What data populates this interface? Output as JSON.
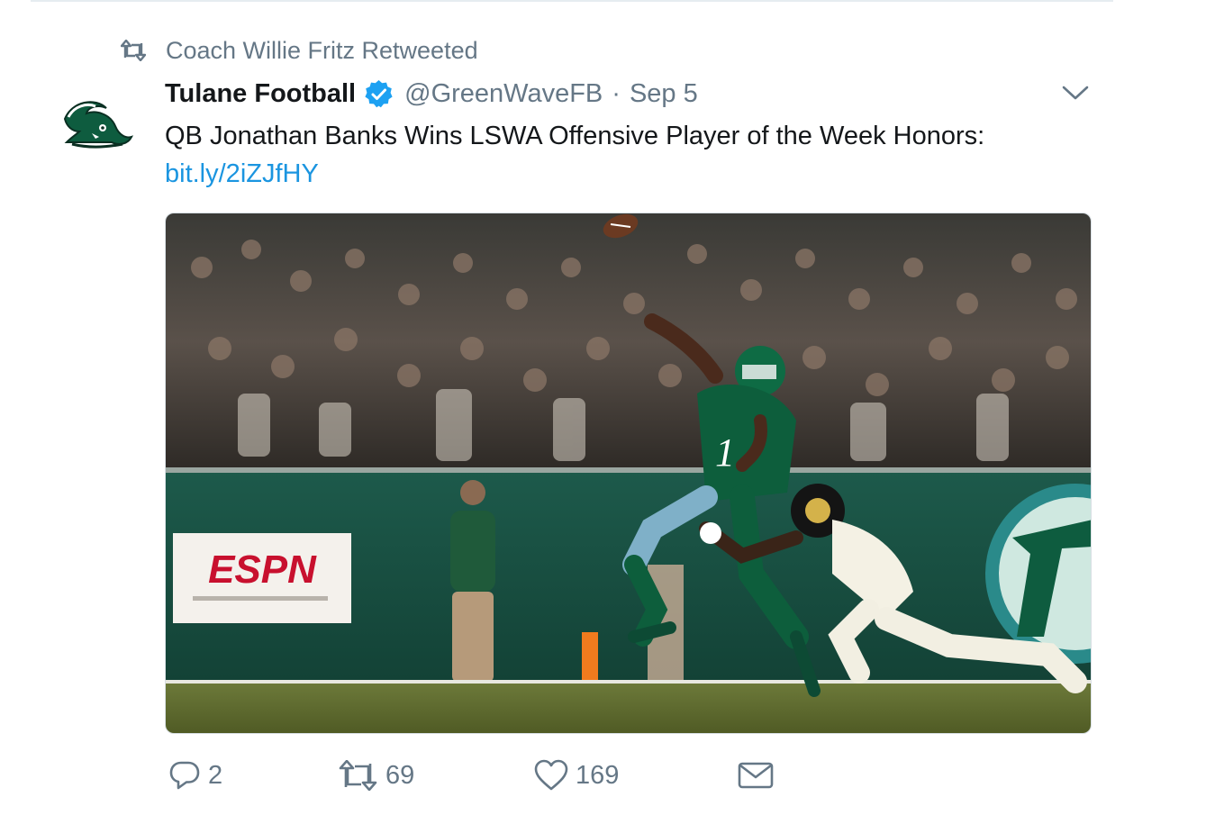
{
  "retweet_context": {
    "icon": "retweet-icon",
    "text": "Coach Willie Fritz Retweeted"
  },
  "tweet": {
    "avatar": "green-wave-logo",
    "fullname": "Tulane Football",
    "verified_icon": "verified-badge-icon",
    "handle": "@GreenWaveFB",
    "separator": "·",
    "time": "Sep 5",
    "text": "QB Jonathan Banks Wins LSWA Offensive Player of the Week Honors:",
    "link": "bit.ly/2iZJfHY",
    "media": {
      "description_icon": "football-photo",
      "sign_text": "ESPN"
    }
  },
  "actions": {
    "reply_count": "2",
    "retweet_count": "69",
    "like_count": "169"
  },
  "colors": {
    "link": "#1b95e0",
    "secondary_text": "#657786",
    "verified": "#1da1f2",
    "tulane_green": "#0e5c3f"
  }
}
